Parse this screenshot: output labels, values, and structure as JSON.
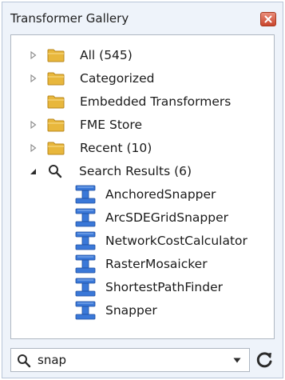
{
  "window": {
    "title": "Transformer Gallery",
    "close_icon": "close-icon"
  },
  "tree": {
    "items": [
      {
        "label": "All (545)",
        "icon": "folder-icon",
        "expander": "collapsed"
      },
      {
        "label": "Categorized",
        "icon": "folder-icon",
        "expander": "collapsed"
      },
      {
        "label": "Embedded Transformers",
        "icon": "folder-icon",
        "expander": "none"
      },
      {
        "label": "FME Store",
        "icon": "folder-icon",
        "expander": "collapsed"
      },
      {
        "label": "Recent (10)",
        "icon": "folder-icon",
        "expander": "collapsed"
      },
      {
        "label": "Search Results (6)",
        "icon": "search-icon",
        "expander": "expanded"
      }
    ],
    "search_results": [
      {
        "label": "AnchoredSnapper",
        "icon": "transformer-icon"
      },
      {
        "label": "ArcSDEGridSnapper",
        "icon": "transformer-icon"
      },
      {
        "label": "NetworkCostCalculator",
        "icon": "transformer-icon"
      },
      {
        "label": "RasterMosaicker",
        "icon": "transformer-icon"
      },
      {
        "label": "ShortestPathFinder",
        "icon": "transformer-icon"
      },
      {
        "label": "Snapper",
        "icon": "transformer-icon"
      }
    ]
  },
  "search": {
    "value": "snap",
    "icon": "search-icon",
    "dropdown_icon": "chevron-down-icon",
    "refresh_icon": "refresh-icon"
  },
  "colors": {
    "folder": "#e8b73c",
    "transformer": "#3a78d8",
    "close_button": "#d3533b",
    "panel_background": "#eef3fa"
  }
}
